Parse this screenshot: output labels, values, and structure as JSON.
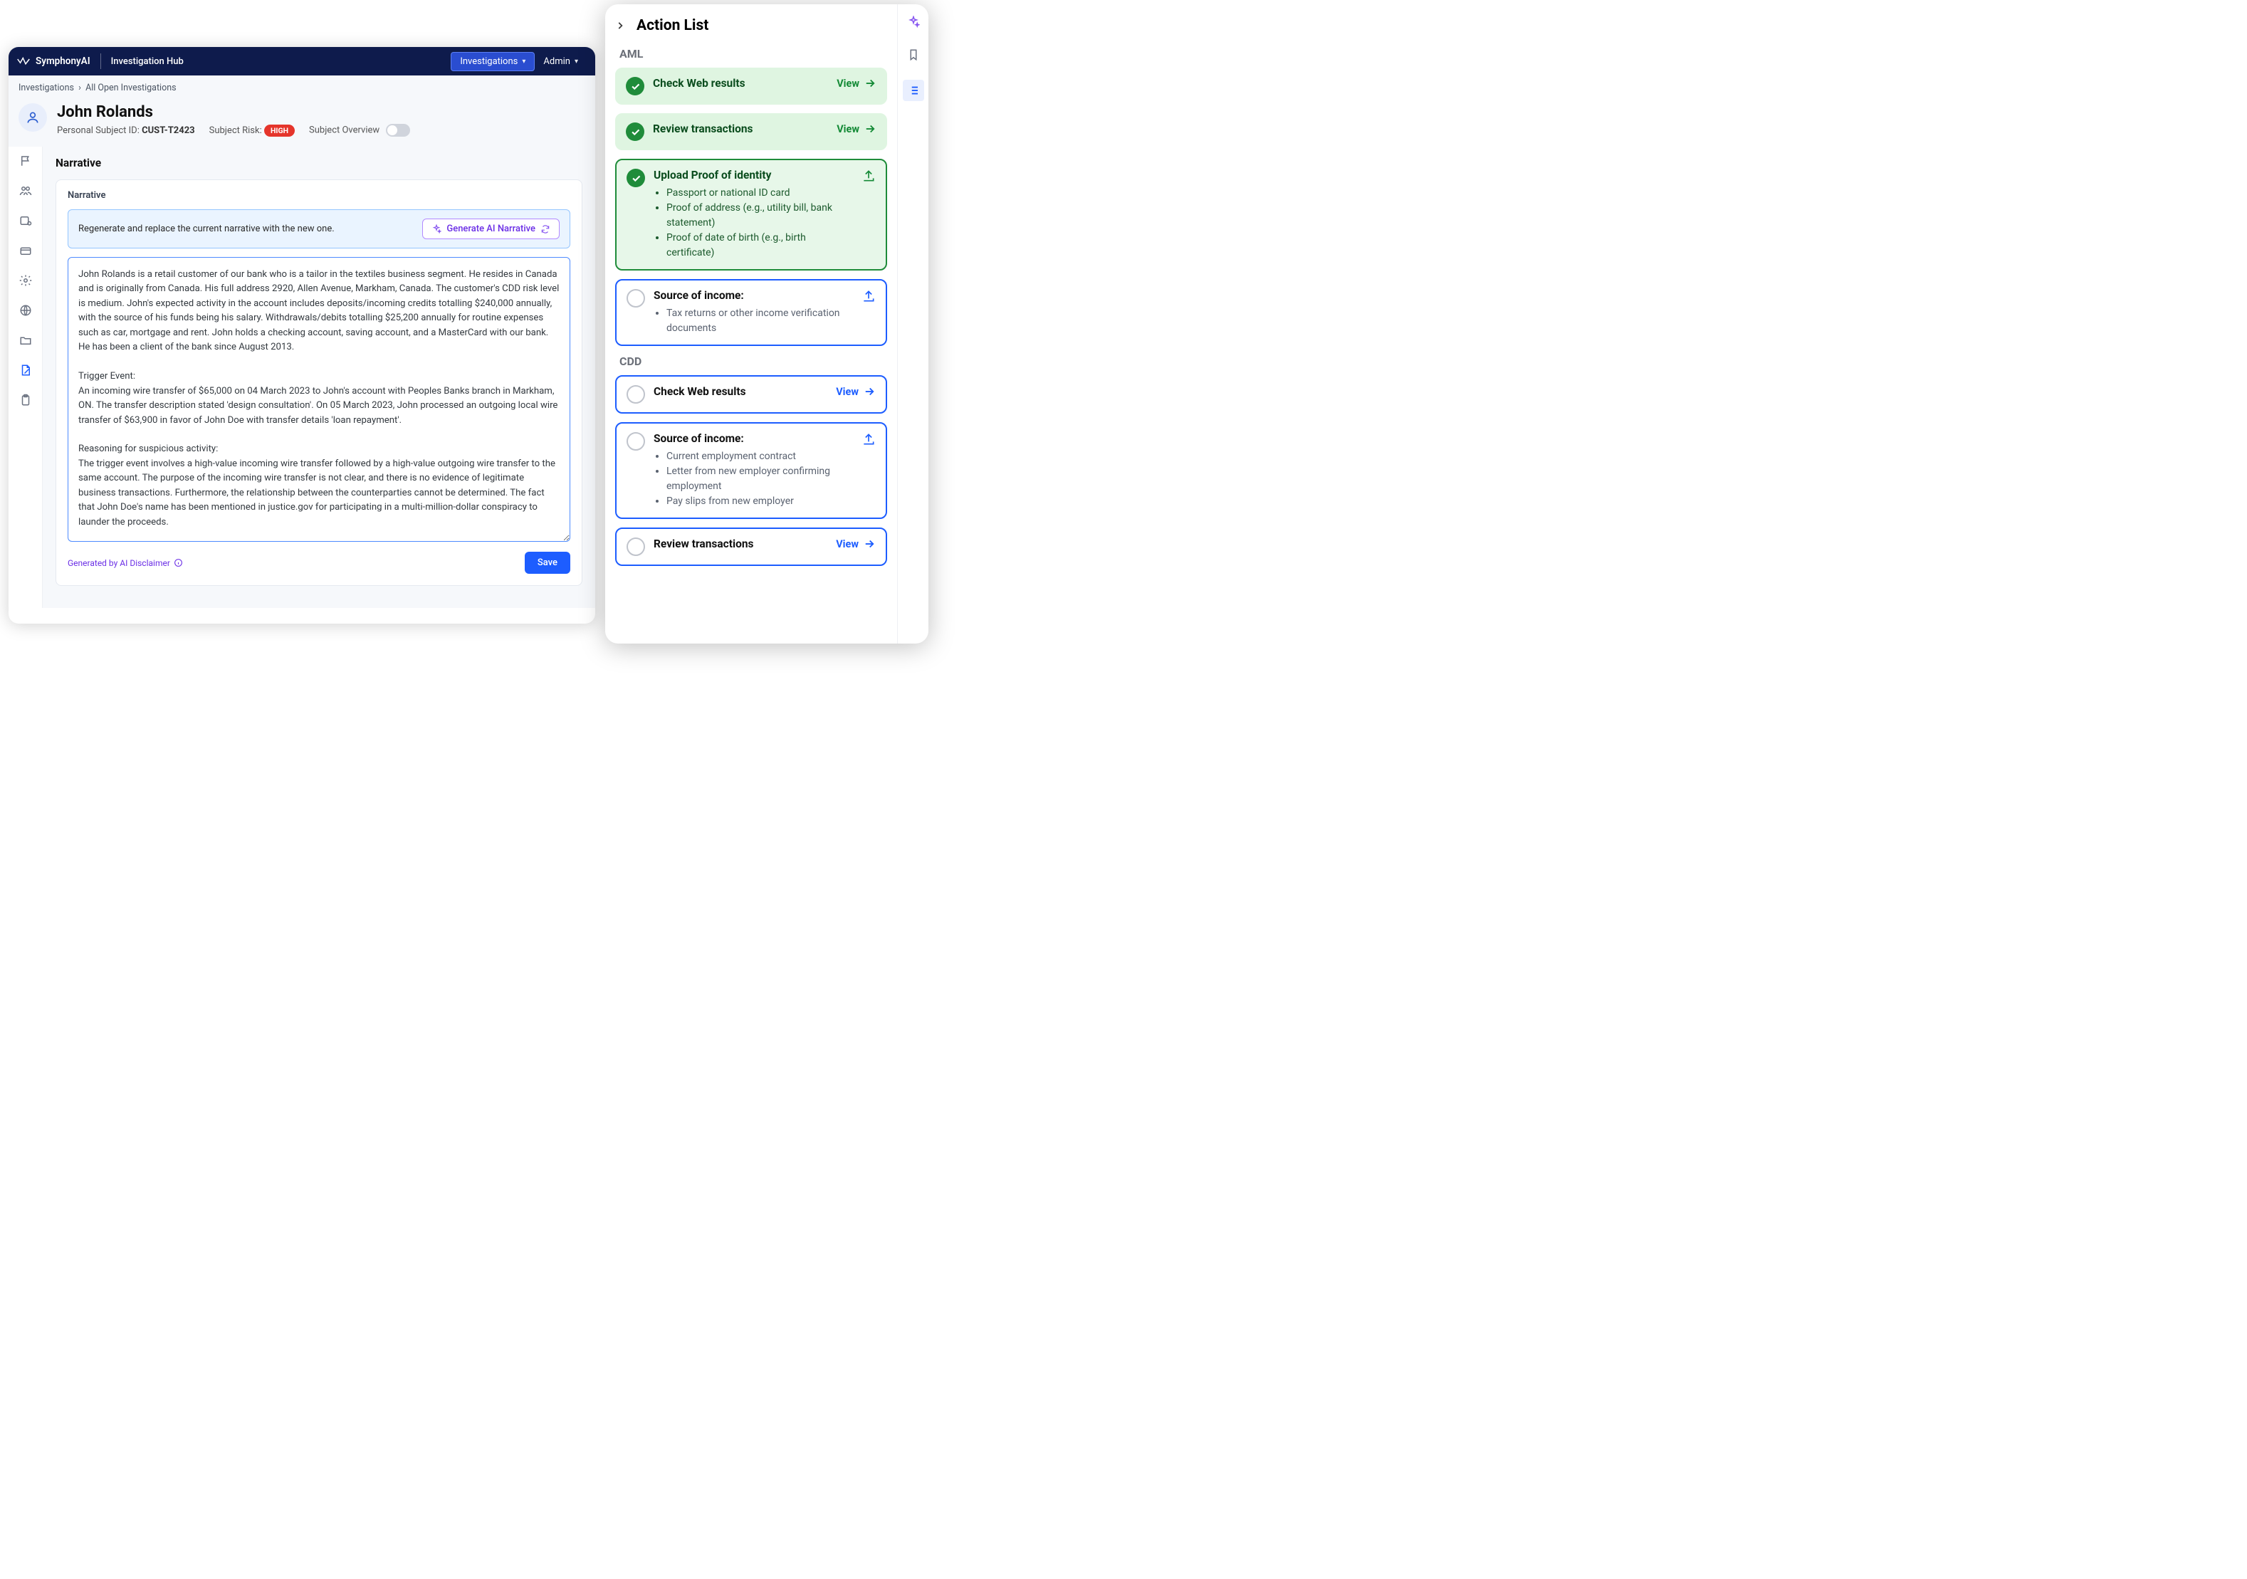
{
  "appName": "SymphonyAI",
  "hubName": "Investigation Hub",
  "nav": {
    "investigations": "Investigations",
    "admin": "Admin"
  },
  "breadcrumb": {
    "root": "Investigations",
    "current": "All Open Investigations"
  },
  "subject": {
    "name": "John Rolands",
    "idLabel": "Personal Subject ID:",
    "idValue": "CUST-T2423",
    "riskLabel": "Subject Risk:",
    "riskValue": "HIGH",
    "overviewLabel": "Subject Overview"
  },
  "section": {
    "title": "Narrative",
    "cardLabel": "Narrative"
  },
  "regen": {
    "text": "Regenerate and replace the current narrative with the new one.",
    "button": "Generate AI Narrative"
  },
  "narrativeText": "John Rolands is a retail customer of our bank who is a tailor in the textiles business segment. He resides in Canada and is originally from Canada. His full address 2920, Allen Avenue, Markham, Canada. The customer's CDD risk level is medium. John's expected activity in the account includes deposits/incoming credits totalling $240,000 annually, with the source of his funds being his salary. Withdrawals/debits totalling $25,200 annually for routine expenses such as car, mortgage and rent. John holds a checking account, saving account, and a MasterCard with our bank. He has been a client of the bank since August 2013.\n\nTrigger Event:\nAn incoming wire transfer of $65,000 on 04 March 2023 to John's account with Peoples Banks branch in Markham, ON. The transfer description stated 'design consultation'. On 05 March 2023, John processed an outgoing local wire transfer of $63,900 in favor of John Doe with transfer details 'loan repayment'.\n\nReasoning for suspicious activity:\nThe trigger event involves a high-value incoming wire transfer followed by a high-value outgoing wire transfer to the same account. The purpose of the incoming wire transfer is not clear, and there is no evidence of legitimate business transactions. Furthermore, the relationship between the counterparties cannot be determined. The fact that John Doe's name has been mentioned in justice.gov for participating in a multi-million-dollar conspiracy to launder the proceeds.",
  "footer": {
    "disclaimer": "Generated by AI Disclaimer",
    "save": "Save"
  },
  "actionList": {
    "title": "Action List",
    "viewLabel": "View",
    "groups": {
      "aml": {
        "label": "AML",
        "items": [
          {
            "title": "Check Web results",
            "status": "done",
            "action": "view"
          },
          {
            "title": "Review transactions",
            "status": "done",
            "action": "view"
          },
          {
            "title": "Upload Proof of identity",
            "status": "done-outlined",
            "action": "upload",
            "sub": [
              "Passport or national ID card",
              "Proof of address (e.g., utility bill, bank statement)",
              "Proof of date of birth (e.g., birth certificate)"
            ]
          },
          {
            "title": "Source of income:",
            "status": "open",
            "action": "upload",
            "sub": [
              "Tax returns or other income verification documents"
            ]
          }
        ]
      },
      "cdd": {
        "label": "CDD",
        "items": [
          {
            "title": "Check Web results",
            "status": "open",
            "action": "view"
          },
          {
            "title": "Source of income:",
            "status": "open",
            "action": "upload",
            "sub": [
              "Current employment contract",
              "Letter from new employer confirming employment",
              "Pay slips from new employer"
            ]
          },
          {
            "title": "Review transactions",
            "status": "open",
            "action": "view"
          }
        ]
      }
    }
  }
}
